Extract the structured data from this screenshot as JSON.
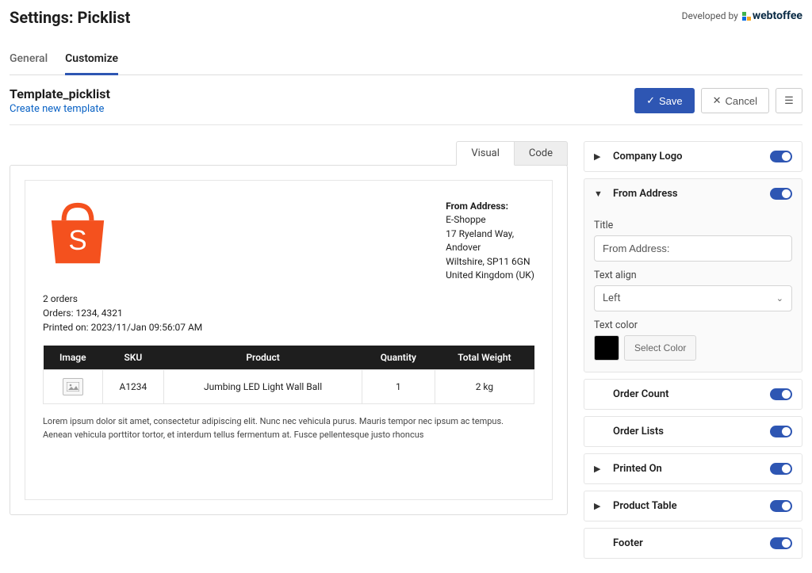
{
  "header": {
    "title": "Settings: Picklist",
    "developed_by": "Developed by",
    "brand": "webtoffee"
  },
  "tabs": {
    "general": "General",
    "customize": "Customize"
  },
  "template": {
    "name": "Template_picklist",
    "create_link": "Create new template"
  },
  "buttons": {
    "save": "Save",
    "cancel": "Cancel"
  },
  "view_tabs": {
    "visual": "Visual",
    "code": "Code"
  },
  "doc": {
    "from_title": "From Address:",
    "from_lines": [
      "E-Shoppe",
      "17 Ryeland Way,",
      "Andover",
      "Wiltshire, SP11 6GN",
      "United Kingdom (UK)"
    ],
    "meta": {
      "order_count": "2 orders",
      "orders": "Orders: 1234, 4321",
      "printed_on": "Printed on: 2023/11/Jan 09:56:07 AM"
    },
    "columns": [
      "Image",
      "SKU",
      "Product",
      "Quantity",
      "Total Weight"
    ],
    "row": {
      "sku": "A1234",
      "product": "Jumbing LED Light Wall Ball",
      "qty": "1",
      "weight": "2 kg"
    },
    "footer": "Lorem ipsum dolor sit amet, consectetur adipiscing elit. Nunc nec vehicula purus. Mauris tempor nec ipsum ac tempus. Aenean vehicula porttitor tortor, et interdum tellus fermentum at. Fusce pellentesque justo rhoncus"
  },
  "panels": {
    "company_logo": "Company Logo",
    "from_address": "From Address",
    "order_count": "Order Count",
    "order_lists": "Order Lists",
    "printed_on": "Printed On",
    "product_table": "Product Table",
    "footer": "Footer"
  },
  "from_form": {
    "title_label": "Title",
    "title_value": "From Address:",
    "align_label": "Text align",
    "align_value": "Left",
    "color_label": "Text color",
    "color_btn": "Select Color"
  }
}
